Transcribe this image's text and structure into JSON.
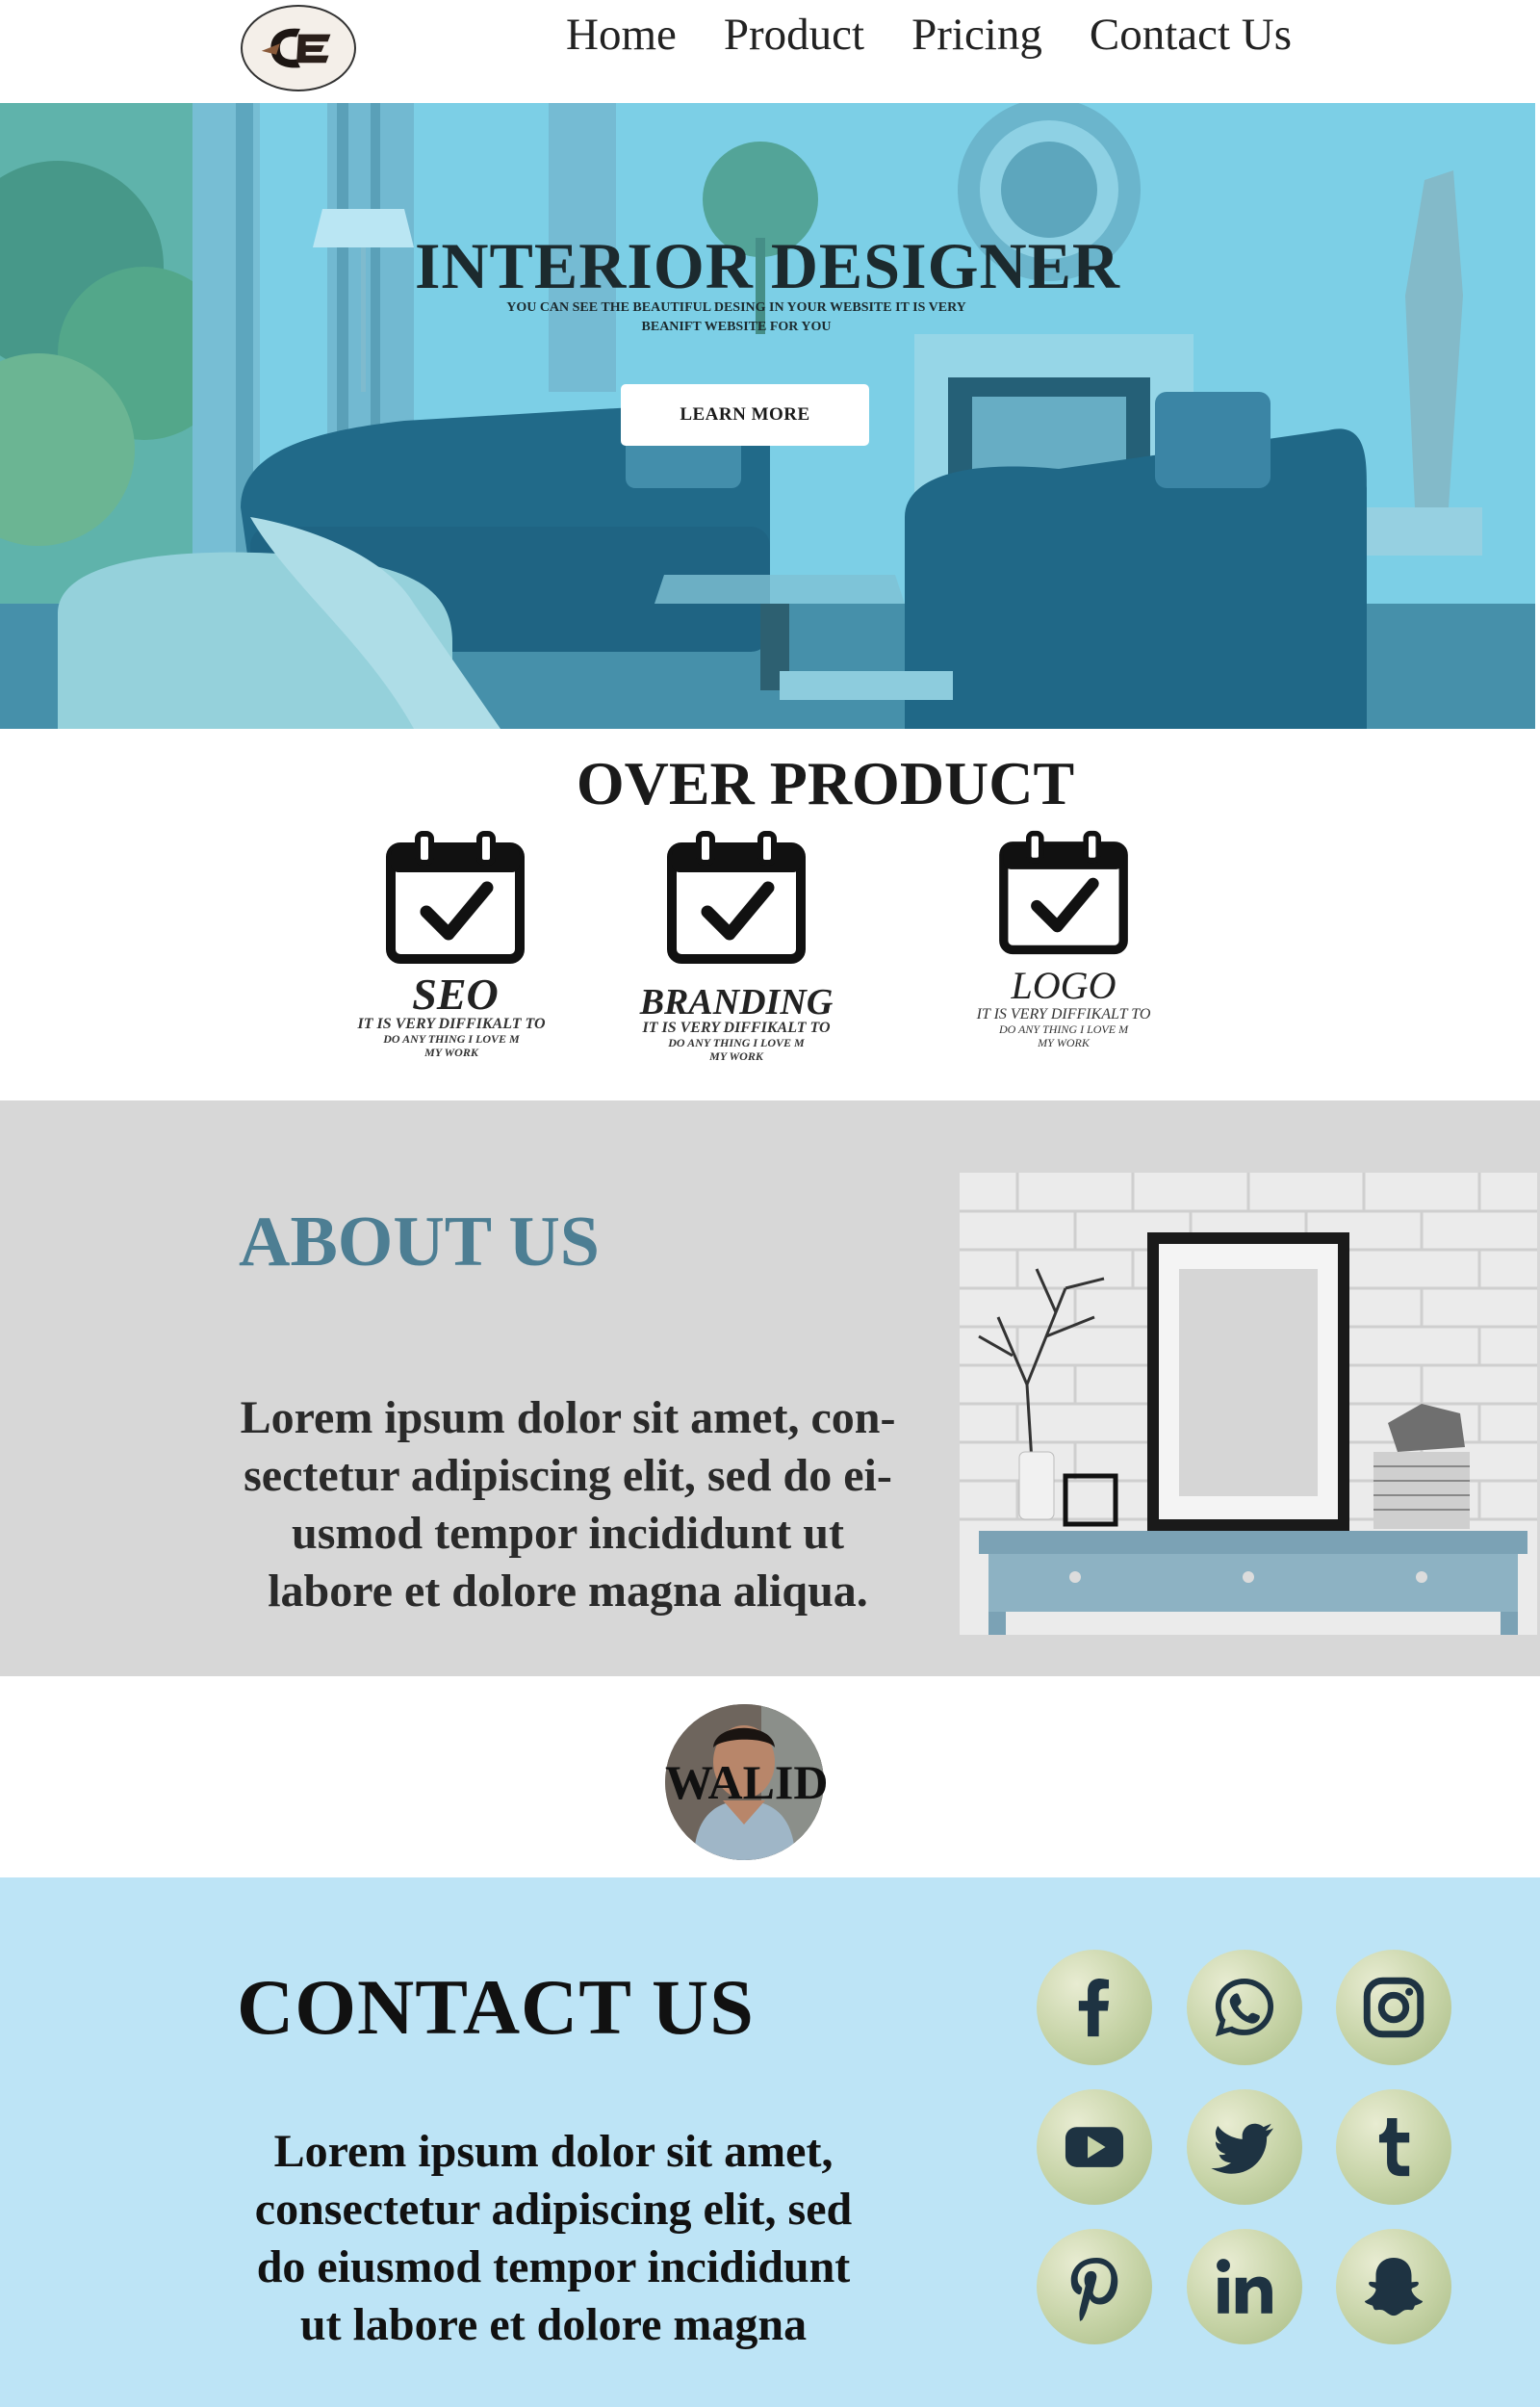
{
  "nav": {
    "logo_text": "CE",
    "links": [
      "Home",
      "Product",
      "Pricing",
      "Contact Us"
    ]
  },
  "hero": {
    "title": "INTERIOR DESIGNER",
    "subtitle_line1": "YOU CAN SEE THE BEAUTIFUL DESING IN YOUR WEBSITE IT IS VERY",
    "subtitle_line2": "BEANIFT WEBSITE FOR YOU",
    "button_label": "LEARN MORE"
  },
  "products": {
    "title": "OVER PRODUCT",
    "items": [
      {
        "name": "SEO",
        "desc_line1": "IT IS VERY DIFFIKALT TO",
        "desc_line2": "DO ANY THING I LOVE M",
        "desc_line3": "MY WORK",
        "icon": "calendar-check-icon"
      },
      {
        "name": "BRANDING",
        "desc_line1": "IT IS VERY DIFFIKALT TO",
        "desc_line2": "DO ANY THING I LOVE M",
        "desc_line3": "MY WORK",
        "icon": "calendar-check-icon"
      },
      {
        "name": "LOGO",
        "desc_line1": "IT IS VERY DIFFIKALT TO",
        "desc_line2": "DO ANY THING I LOVE M",
        "desc_line3": "MY WORK",
        "icon": "calendar-check-icon"
      }
    ]
  },
  "about": {
    "title": "ABOUT US",
    "text_line1": "Lorem ipsum dolor sit amet, con-",
    "text_line2": "sectetur adipiscing elit, sed do ei-",
    "text_line3": "usmod tempor incididunt ut",
    "text_line4": "labore et dolore magna aliqua."
  },
  "profile": {
    "name": "WALID"
  },
  "contact": {
    "title": "CONTACT US",
    "text_line1": "Lorem ipsum dolor sit amet,",
    "text_line2": "consectetur adipiscing elit, sed",
    "text_line3": "do eiusmod tempor incididunt",
    "text_line4": "ut labore et dolore magna",
    "social": [
      "facebook-icon",
      "whatsapp-icon",
      "instagram-icon",
      "youtube-icon",
      "twitter-icon",
      "tumblr-icon",
      "pinterest-icon",
      "linkedin-icon",
      "snapchat-icon"
    ]
  },
  "colors": {
    "hero_tint": "#72c2d9",
    "about_bg": "#d7d7d7",
    "about_title": "#4d7e93",
    "contact_bg": "#bde4f6",
    "social_badge": "#c6d3a6",
    "social_glyph": "#1e3342"
  }
}
